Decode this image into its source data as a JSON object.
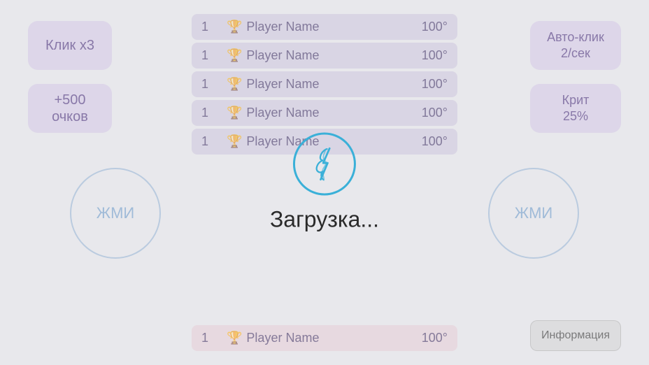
{
  "leaderboard": {
    "rows": [
      {
        "rank": "1",
        "icon": "🏆",
        "name": "Player Name",
        "score": "100°"
      },
      {
        "rank": "1",
        "icon": "🏆",
        "name": "Player Name",
        "score": "100°"
      },
      {
        "rank": "1",
        "icon": "🏆",
        "name": "Player Name",
        "score": "100°"
      },
      {
        "rank": "1",
        "icon": "🏆",
        "name": "Player Name",
        "score": "100°"
      },
      {
        "rank": "1",
        "icon": "🏆",
        "name": "Player Name",
        "score": "100°"
      }
    ],
    "bottom_row": {
      "rank": "1",
      "icon": "🏆",
      "name": "Player Name",
      "score": "100°"
    }
  },
  "buttons": {
    "click_x3": "Клик х3",
    "plus_500": "+500\nочков",
    "auto_click": "Авто-клик\n2/сек",
    "crit": "Крит\n25%",
    "press_left": "ЖМИ",
    "press_right": "ЖМИ",
    "info": "Информация"
  },
  "loading": {
    "text": "Загрузка..."
  },
  "colors": {
    "accent_blue": "#3ab0d8",
    "text_dark": "#2a2a2a",
    "text_purple": "rgba(100,80,140,0.7)"
  }
}
